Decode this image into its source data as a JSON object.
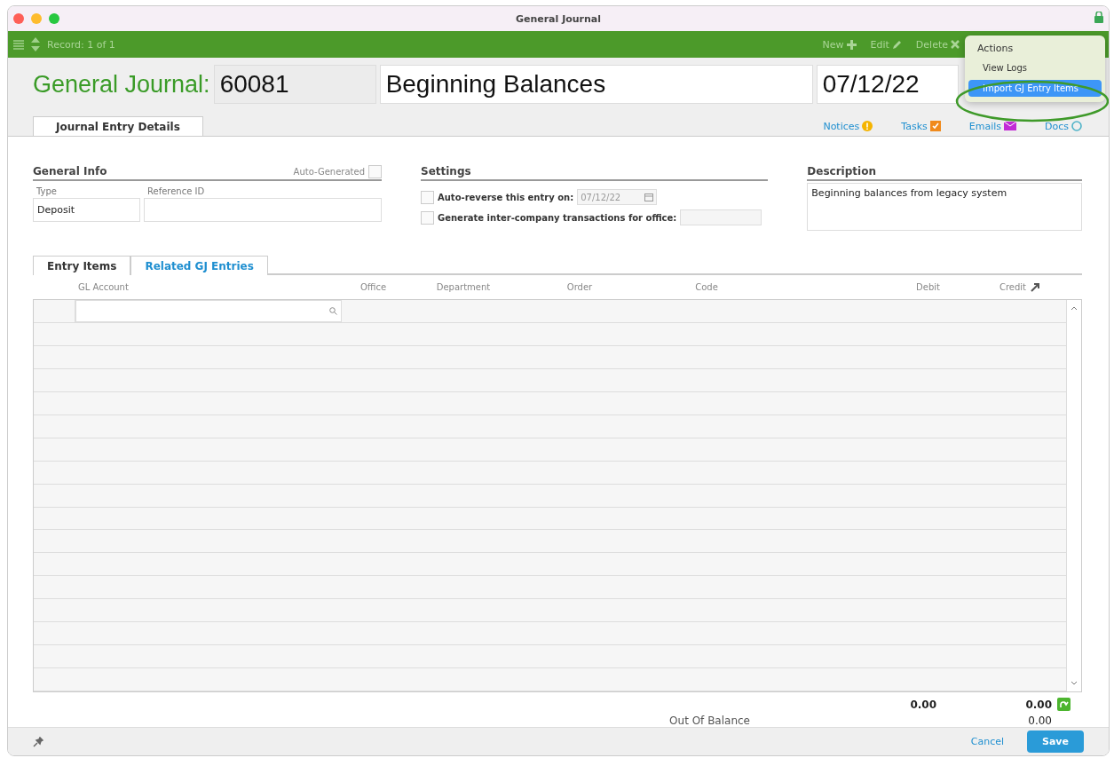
{
  "window": {
    "title": "General Journal"
  },
  "toolbar": {
    "record": "Record: 1 of 1",
    "buttons": [
      {
        "label": "New",
        "kind": "plus"
      },
      {
        "label": "Edit",
        "kind": "pencil"
      },
      {
        "label": "Delete",
        "kind": "cross"
      }
    ]
  },
  "actions_menu": {
    "title": "Actions",
    "items": [
      {
        "label": "View Logs",
        "selected": false
      },
      {
        "label": "Import GJ Entry Items",
        "selected": true
      }
    ]
  },
  "header": {
    "label": "General Journal:",
    "number": "60081",
    "name": "Beginning Balances",
    "date": "07/12/22"
  },
  "tabs": [
    {
      "label": "Journal Entry Details",
      "selected": true
    }
  ],
  "links": [
    {
      "label": "Notices",
      "kind": "notice"
    },
    {
      "label": "Tasks",
      "kind": "task"
    },
    {
      "label": "Emails",
      "kind": "email"
    },
    {
      "label": "Docs",
      "kind": "doc"
    }
  ],
  "general_info": {
    "title": "General Info",
    "auto_generated_label": "Auto-Generated",
    "auto_generated": false,
    "fields": [
      {
        "label": "Type",
        "value": "Deposit"
      },
      {
        "label": "Reference ID"
      }
    ]
  },
  "settings": {
    "title": "Settings",
    "options": [
      {
        "label": "Auto-reverse this entry on:",
        "checked": false,
        "value": "07/12/22"
      },
      {
        "label": "Generate inter-company transactions for office:",
        "checked": false
      }
    ]
  },
  "description": {
    "title": "Description",
    "value": "Beginning balances from legacy system"
  },
  "entry_tabs": [
    {
      "label": "Entry Items",
      "selected": true
    },
    {
      "label": "Related GJ Entries",
      "selected": false
    }
  ],
  "table": {
    "columns": [
      "GL Account",
      "Office",
      "Department",
      "Order",
      "Code",
      "Debit",
      "Credit"
    ]
  },
  "totals": {
    "debit": "0.00",
    "credit": "0.00",
    "out_of_balance_label": "Out Of Balance",
    "out_of_balance": "0.00"
  },
  "footer": {
    "cancel": "Cancel",
    "save": "Save"
  }
}
